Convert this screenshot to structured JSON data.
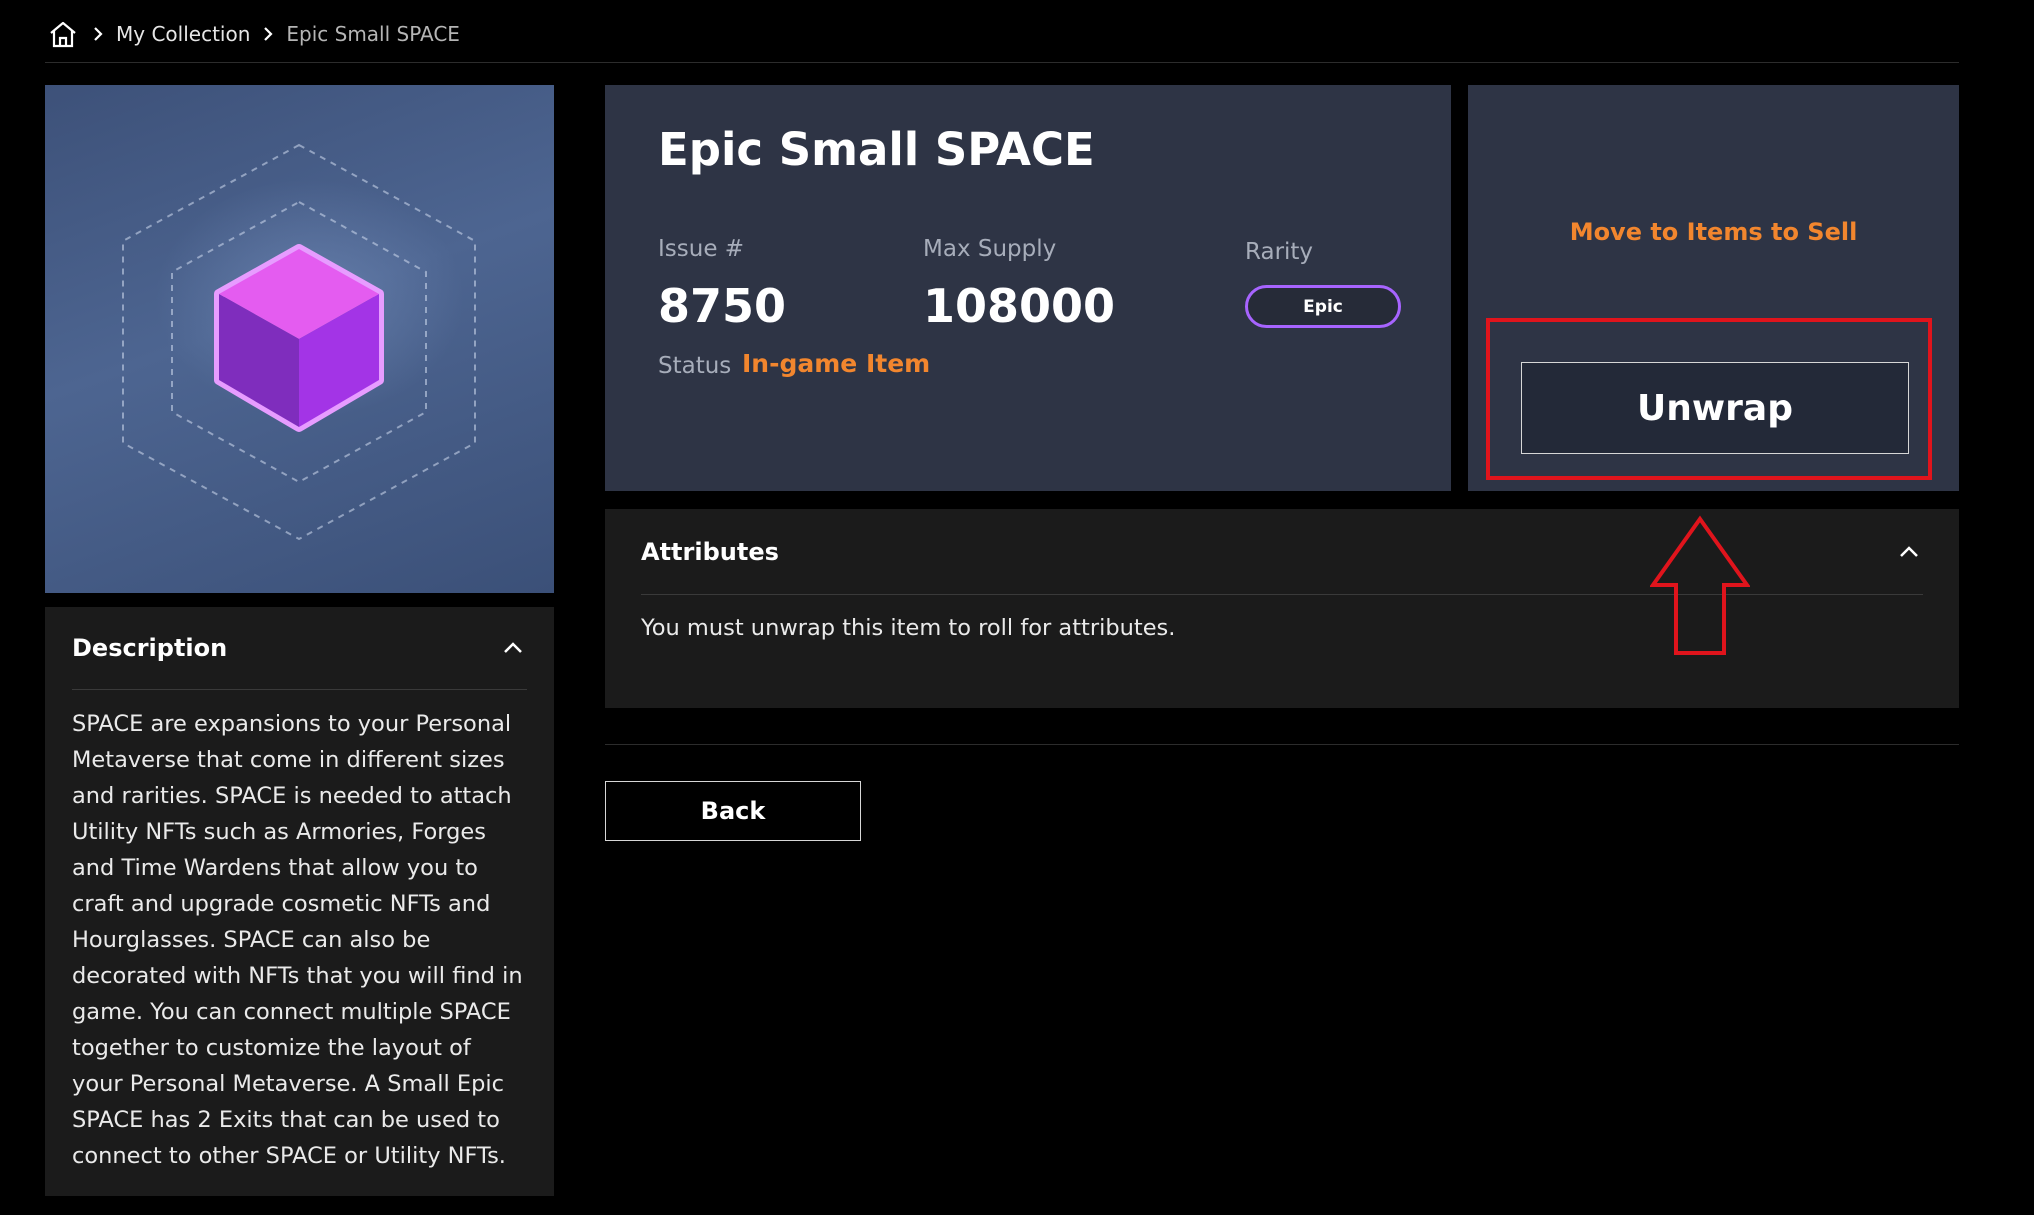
{
  "breadcrumb": {
    "home_icon": "home-icon",
    "items": [
      "My Collection",
      "Epic Small SPACE"
    ]
  },
  "item": {
    "title": "Epic Small SPACE",
    "issue_label": "Issue #",
    "issue_value": "8750",
    "max_supply_label": "Max Supply",
    "max_supply_value": "108000",
    "rarity_label": "Rarity",
    "rarity_value": "Epic",
    "status_label": "Status",
    "status_value": "In-game Item"
  },
  "actions": {
    "move_label": "Move to Items to Sell",
    "unwrap_label": "Unwrap"
  },
  "description": {
    "heading": "Description",
    "text": "SPACE are expansions to your Personal Metaverse that come in different sizes and rarities. SPACE is needed to attach Utility NFTs such as Armories, Forges and Time Wardens that allow you to craft and upgrade cosmetic NFTs and Hourglasses. SPACE can also be decorated with NFTs that you will find in game. You can connect multiple SPACE together to customize the layout of your Personal Metaverse. A Small Epic SPACE has 2 Exits that can be used to connect to other SPACE or Utility NFTs."
  },
  "attributes": {
    "heading": "Attributes",
    "text": "You must unwrap this item to roll for attributes."
  },
  "back_label": "Back",
  "colors": {
    "accent_orange": "#f2862e",
    "rarity_purple": "#a764ff",
    "highlight_red": "#e0141c",
    "card_bg": "#2e3445"
  }
}
